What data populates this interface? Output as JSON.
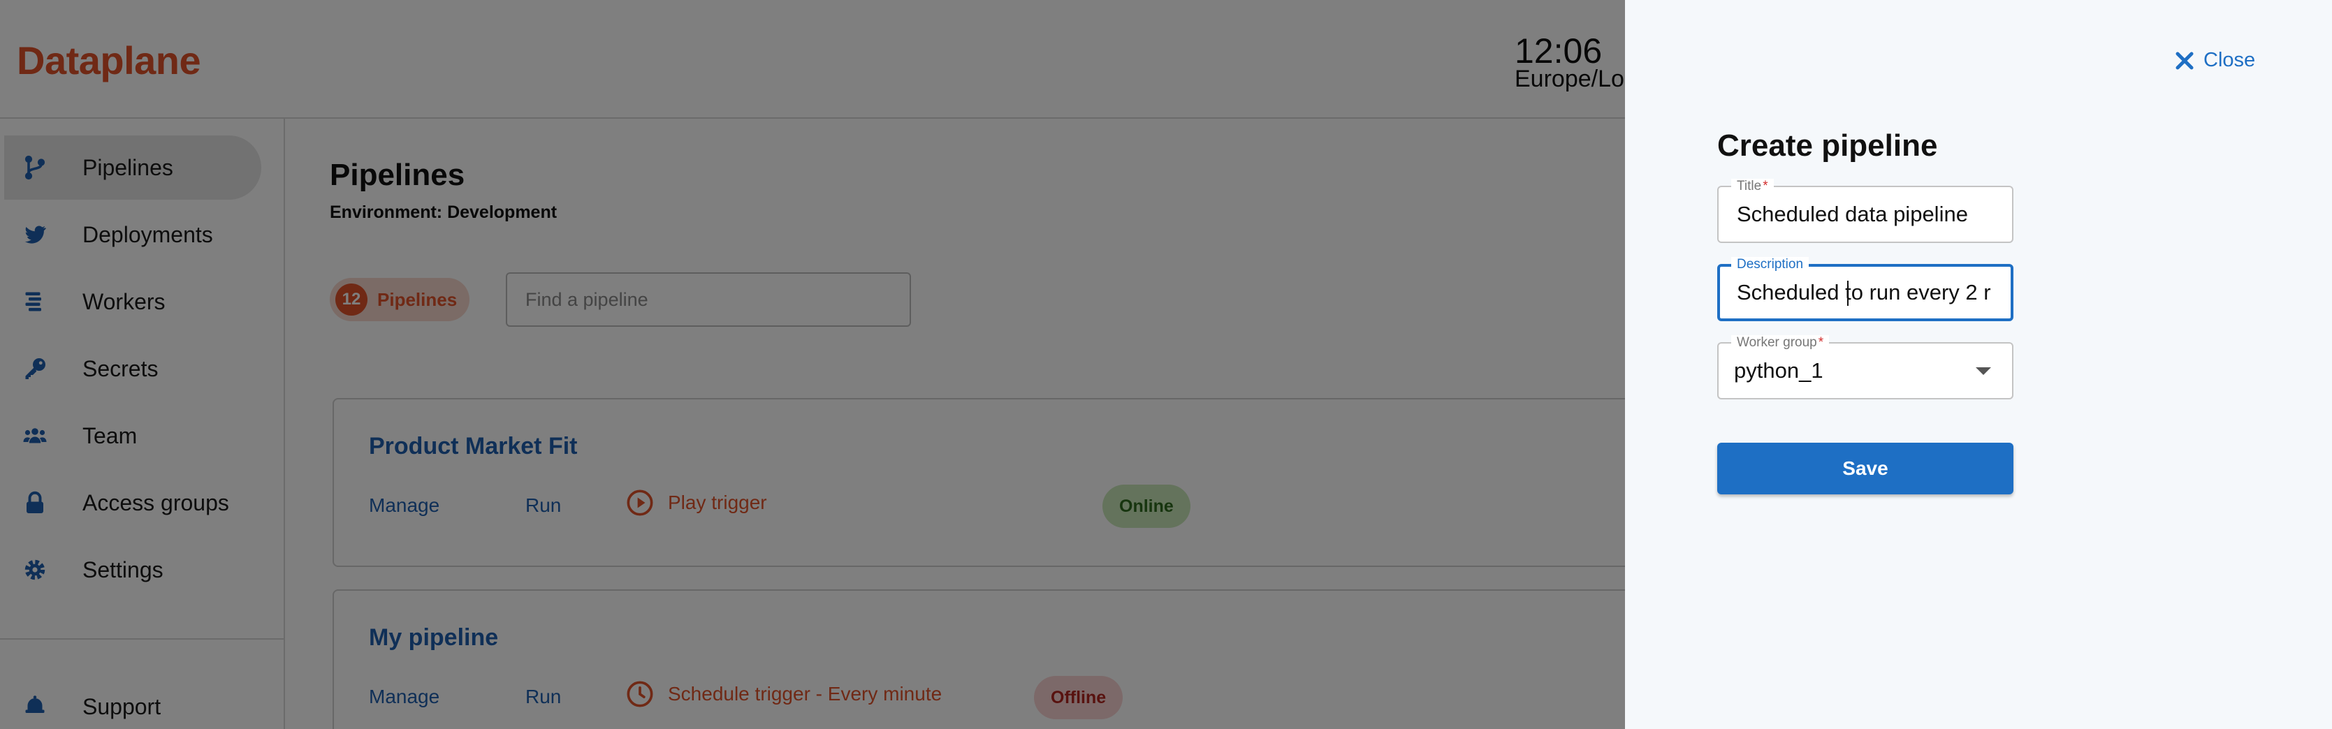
{
  "app": {
    "logo": "Dataplane"
  },
  "clock": {
    "time": "12:06",
    "zone": "Europe/Lo"
  },
  "sidebar": {
    "items": [
      {
        "label": "Pipelines",
        "icon": "pipeline-branch-icon",
        "active": true
      },
      {
        "label": "Deployments",
        "icon": "bird-icon",
        "active": false
      },
      {
        "label": "Workers",
        "icon": "workers-bars-icon",
        "active": false
      },
      {
        "label": "Secrets",
        "icon": "key-icon",
        "active": false
      },
      {
        "label": "Team",
        "icon": "team-users-icon",
        "active": false
      },
      {
        "label": "Access groups",
        "icon": "lock-icon",
        "active": false
      },
      {
        "label": "Settings",
        "icon": "gear-icon",
        "active": false
      }
    ],
    "support": {
      "label": "Support",
      "icon": "bell-icon"
    }
  },
  "main": {
    "title": "Pipelines",
    "environment": "Environment: Development",
    "count": "12",
    "count_label": "Pipelines",
    "search_placeholder": "Find a pipeline",
    "pipelines": [
      {
        "name": "Product Market Fit",
        "manage": "Manage",
        "run": "Run",
        "trigger": "Play trigger",
        "trigger_icon": "play-circle-icon",
        "status": "Online"
      },
      {
        "name": "My pipeline",
        "manage": "Manage",
        "run": "Run",
        "trigger": "Schedule trigger - Every minute",
        "trigger_icon": "clock-icon",
        "status": "Offline"
      }
    ]
  },
  "drawer": {
    "close_label": "Close",
    "title": "Create pipeline",
    "fields": {
      "title": {
        "label": "Title",
        "value": "Scheduled data pipeline",
        "required_mark": "*"
      },
      "description": {
        "label": "Description",
        "value": "Scheduled to run every 2 r"
      },
      "worker_group": {
        "label": "Worker group",
        "value": "python_1",
        "required_mark": "*"
      }
    },
    "save_label": "Save"
  },
  "colors": {
    "brand": "#e0522b",
    "primary": "#1e6fc4",
    "link": "#1e5fae",
    "online_bg": "#c9e6b8",
    "offline_bg": "#f8d2d2"
  }
}
